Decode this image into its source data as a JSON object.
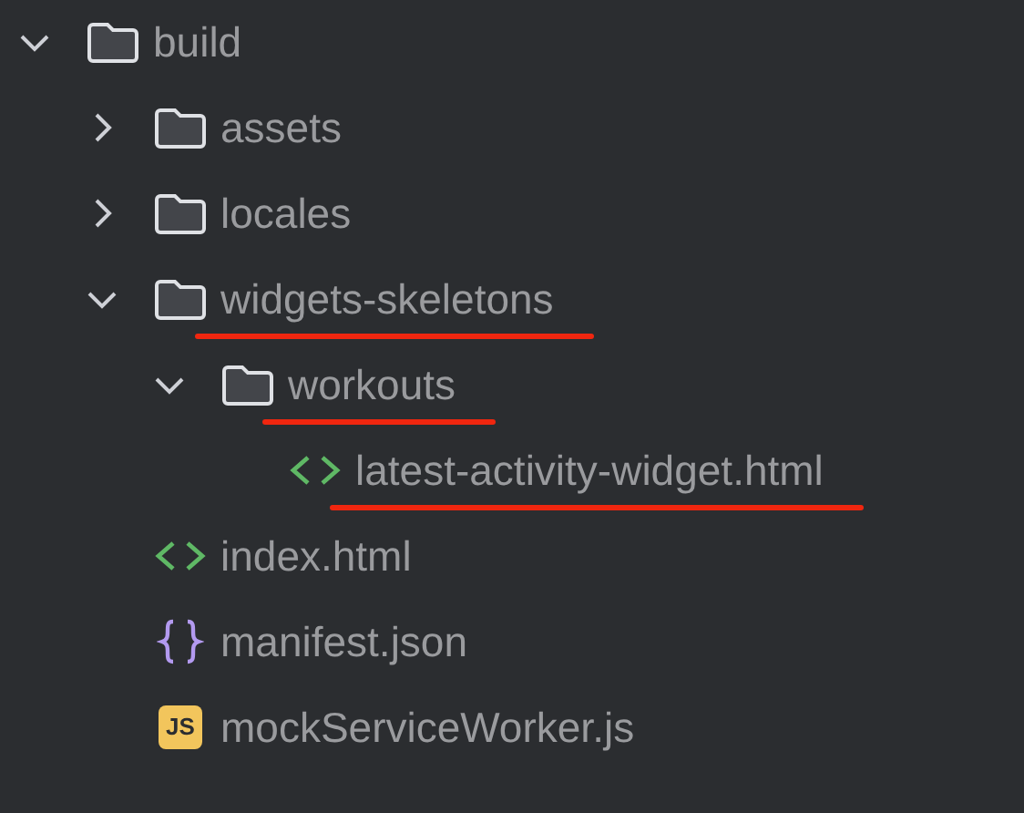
{
  "tree": [
    {
      "kind": "folder",
      "name": "build",
      "expanded": true,
      "underlined": false,
      "children": [
        {
          "kind": "folder",
          "name": "assets",
          "expanded": false,
          "underlined": false
        },
        {
          "kind": "folder",
          "name": "locales",
          "expanded": false,
          "underlined": false
        },
        {
          "kind": "folder",
          "name": "widgets-skeletons",
          "expanded": true,
          "underlined": true,
          "children": [
            {
              "kind": "folder",
              "name": "workouts",
              "expanded": true,
              "underlined": true,
              "children": [
                {
                  "kind": "html",
                  "name": "latest-activity-widget.html",
                  "underlined": true
                }
              ]
            }
          ]
        },
        {
          "kind": "html",
          "name": "index.html",
          "underlined": false
        },
        {
          "kind": "json",
          "name": "manifest.json",
          "underlined": false
        },
        {
          "kind": "js",
          "name": "mockServiceWorker.js",
          "badge": "JS",
          "underlined": false
        }
      ]
    }
  ]
}
